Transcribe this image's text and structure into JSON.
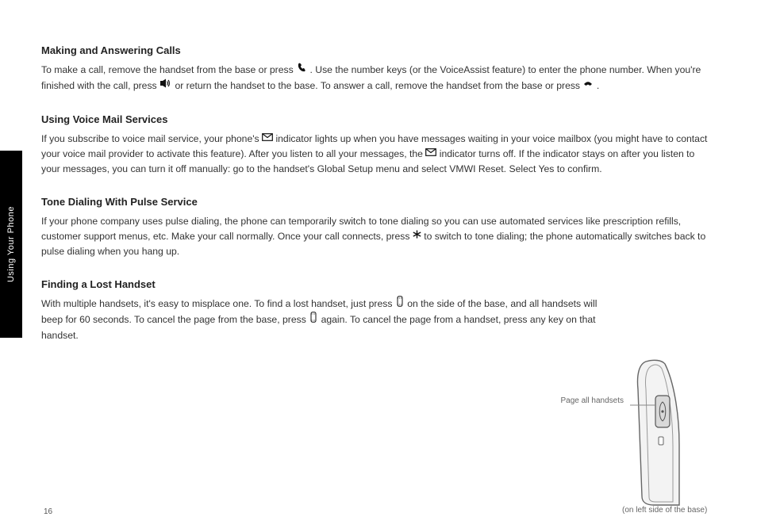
{
  "sideTab": "Using Your Phone",
  "basics": {
    "title": "Making and Answering Calls",
    "makeCall_a": "To make a call, remove the handset from the base or press",
    "makeCall_b": ". Use the number keys (or the VoiceAssist feature) to enter",
    "makeCall_c": "the phone number. When you're finished with the call, press",
    "makeCall_d": "or return the handset to the base. To answer a call, remove",
    "makeCall_e": "the handset from the base or press",
    "makeCall_f": "."
  },
  "vm": {
    "title": "Using Voice Mail Services",
    "line1_a": "If you subscribe to voice mail service, your phone's",
    "line1_b": "indicator lights up when you have messages waiting in your voice",
    "line1_c": "mailbox (you might have to contact your voice mail provider to activate this feature). After you listen to all your messages, the",
    "line1_d": "indicator",
    "line1_e": "turns off. If the indicator stays on after you listen to your messages, you can turn it off manually: go to the handset's Global Setup menu",
    "line1_f": "and select VMWI Reset. Select Yes to confirm."
  },
  "tone": {
    "title": "Tone Dialing With Pulse Service",
    "line_a": "If your phone company uses pulse dialing, the phone can temporarily switch to tone dialing so you can use automated services like",
    "line_b": "prescription refills, customer support menus, etc. Make your call normally. Once your call connects, press",
    "line_c": "to switch to tone dialing; the phone automatically switches back to pulse dialing when you hang up."
  },
  "find": {
    "title": "Finding a Lost Handset",
    "line_a": "With multiple handsets, it's easy to misplace one. To find a lost handset, just press",
    "line_b": "on the side of the",
    "line_c": "base, and all handsets will beep for 60 seconds. To cancel the page from the base, press",
    "line_d": "again. To cancel",
    "line_e": "the page from a handset, press any key on that handset."
  },
  "captions": {
    "left": "Page all handsets",
    "right": "(on left side of the base)"
  },
  "pageNumber": "16"
}
